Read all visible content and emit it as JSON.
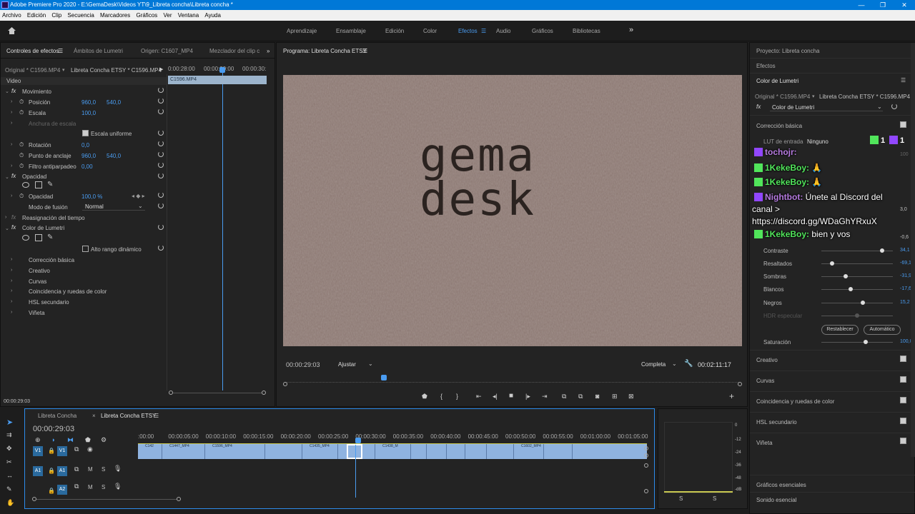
{
  "window": {
    "title": "Adobe Premiere Pro 2020 - E:\\GemaDesk\\Videos YT\\9_Libreta concha\\Libreta concha *",
    "minimize": "—",
    "maximize": "❐",
    "close": "✕"
  },
  "menu": [
    "Archivo",
    "Edición",
    "Clip",
    "Secuencia",
    "Marcadores",
    "Gráficos",
    "Ver",
    "Ventana",
    "Ayuda"
  ],
  "workspaces": {
    "items": [
      "Aprendizaje",
      "Ensamblaje",
      "Edición",
      "Color",
      "Efectos",
      "Audio",
      "Gráficos",
      "Bibliotecas"
    ],
    "active": "Efectos",
    "more": "»"
  },
  "effect_controls": {
    "tabs": [
      "Controles de efectos",
      "Ámbitos de Lumetri",
      "Origen: C1607_MP4",
      "Mezclador del clip c"
    ],
    "source": "Original * C1596.MP4",
    "sequence": "Libreta Concha ETSY * C1596.MP4",
    "ruler": [
      "0:00:28:00",
      "00:00:29:00",
      "00:00:30:"
    ],
    "clip_label": "C1596.MP4",
    "section_video": "Video",
    "movimiento": "Movimiento",
    "posicion": {
      "label": "Posición",
      "x": "960,0",
      "y": "540,0"
    },
    "escala": {
      "label": "Escala",
      "value": "100,0"
    },
    "anchura": {
      "label": "Anchura de escala"
    },
    "escala_uniforme": "Escala uniforme",
    "rotacion": {
      "label": "Rotación",
      "value": "0,0"
    },
    "anclaje": {
      "label": "Punto de anclaje",
      "x": "960,0",
      "y": "540,0"
    },
    "antiparpadeo": {
      "label": "Filtro antiparpadeo",
      "value": "0,00"
    },
    "opacidad_section": "Opacidad",
    "opacidad": {
      "label": "Opacidad",
      "value": "100,0 %"
    },
    "fusion": {
      "label": "Modo de fusión",
      "value": "Normal"
    },
    "reasignacion": "Reasignación del tiempo",
    "lumetri": "Color de Lumetri",
    "alto_rango": "Alto rango dinámico",
    "sub": [
      "Corrección básica",
      "Creativo",
      "Curvas",
      "Coincidencia y ruedas de color",
      "HSL secundario",
      "Viñeta"
    ],
    "timecode": "00:00:29:03"
  },
  "program": {
    "title": "Programa: Libreta Concha ETSY",
    "logo_line1": "gema",
    "logo_line2": "desk",
    "timecode": "00:00:29:03",
    "fit": "Ajustar",
    "quality": "Completa",
    "duration": "00:02:11:17"
  },
  "right_panel": {
    "project": "Proyecto: Libreta concha",
    "efectos": "Efectos",
    "lumetri_title": "Color de Lumetri",
    "source": "Original * C1596.MP4",
    "sequence": "Libreta Concha ETSY * C1596.MP4",
    "fx_select": "Color de Lumetri",
    "correccion": "Corrección básica",
    "lut_label": "LUT de entrada",
    "lut_value": "Ninguno",
    "sliders": [
      {
        "label": "Contraste",
        "value": "34,1",
        "pos": 0.85
      },
      {
        "label": "Resaltados",
        "value": "-69,1",
        "pos": 0.15
      },
      {
        "label": "Sombras",
        "value": "-31,9",
        "pos": 0.34
      },
      {
        "label": "Blancos",
        "value": "-17,6",
        "pos": 0.41
      },
      {
        "label": "Negros",
        "value": "15,2",
        "pos": 0.58
      },
      {
        "label": "HDR especular",
        "value": "",
        "pos": 0.5
      }
    ],
    "hidden_values": [
      "100",
      "3,0",
      "-0,6"
    ],
    "restablecer": "Restablecer",
    "automatico": "Automático",
    "saturacion": {
      "label": "Saturación",
      "value": "100,0",
      "pos": 0.62
    },
    "sections": [
      "Creativo",
      "Curvas",
      "Coincidencia y ruedas de color",
      "HSL secundario",
      "Viñeta"
    ],
    "graficos": "Gráficos esenciales",
    "sonido": "Sonido esencial",
    "badge_k": "1",
    "badge_t": "1"
  },
  "chat": [
    {
      "platform": "twitch",
      "user": "tochojr:",
      "msg": ""
    },
    {
      "platform": "kick",
      "user": "1KekeBoy:",
      "msg": "🙏"
    },
    {
      "platform": "kick",
      "user": "1KekeBoy:",
      "msg": "🙏"
    },
    {
      "platform": "twitch",
      "user": "Nightbot:",
      "msg": "Únete al Discord del"
    },
    {
      "platform": "",
      "user": "",
      "msg": "canal >"
    },
    {
      "platform": "",
      "user": "",
      "msg": "https://discord.gg/WDaGhYRxuX"
    },
    {
      "platform": "kick",
      "user": "1KekeBoy:",
      "msg": "bien y vos"
    }
  ],
  "timeline": {
    "tabs": [
      "Libreta Concha",
      "Libreta Concha ETSY"
    ],
    "close": "×",
    "timecode": "00:00:29:03",
    "ticks": [
      ":00:00",
      "00:00:05:00",
      "00:00:10:00",
      "00:00:15:00",
      "00:00:20:00",
      "00:00:25:00",
      "00:00:30:00",
      "00:00:35:00",
      "00:00:40:00",
      "00:00:45:00",
      "00:00:50:00",
      "00:00:55:00",
      "00:01:00:00",
      "00:01:05:00"
    ],
    "tracks": [
      {
        "name": "V1"
      },
      {
        "name": "A1"
      },
      {
        "name": "A2"
      }
    ],
    "clips": [
      "C142",
      "C1447_MP4",
      "C1596_MP4",
      "",
      "C1435_MP4",
      "",
      "C1438_M",
      "",
      "",
      "",
      "",
      "",
      "C1602_MP4",
      ""
    ],
    "meter_labels": [
      "0",
      "-12",
      "-24",
      "-36",
      "-48",
      "-dB"
    ],
    "meter_s": [
      "S",
      "S"
    ]
  },
  "colors": {
    "accent": "#4a9cf0",
    "clip": "#8fb3e0",
    "panel": "#232323"
  }
}
